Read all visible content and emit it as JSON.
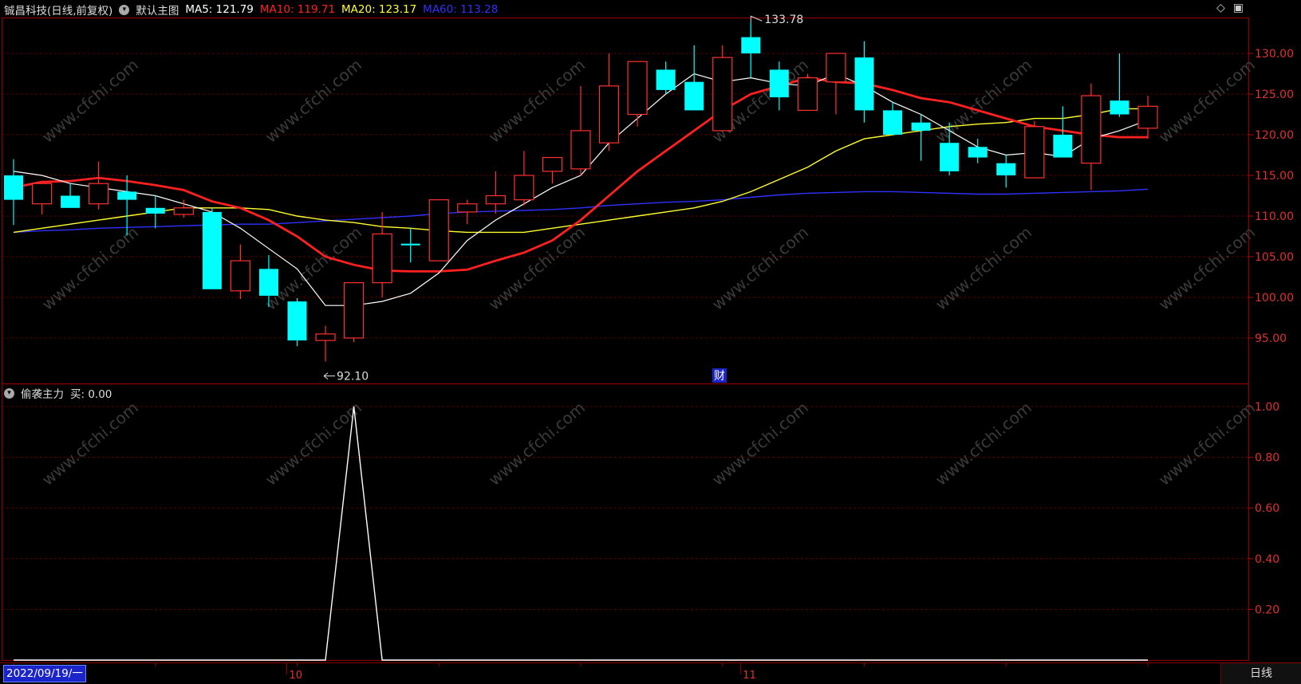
{
  "header": {
    "stock_name": "铖昌科技(日线,前复权)",
    "template": "默认主图",
    "ma5_label": "MA5: 121.79",
    "ma10_label": "MA10: 119.71",
    "ma20_label": "MA20: 123.17",
    "ma60_label": "MA60: 113.28",
    "ma5_color": "#ffffff",
    "ma10_color": "#ff2020",
    "ma20_color": "#ffff30",
    "ma60_color": "#3030ff"
  },
  "indicator": {
    "name": "偷袭主力",
    "buy_label": "买: 0.00"
  },
  "annotations": {
    "high_label": "133.78",
    "low_label": "92.10",
    "cai_badge": "财"
  },
  "watermark": "www.cfchi.com",
  "footer": {
    "date": "2022/09/19/一",
    "month_labels": [
      "10",
      "11"
    ],
    "period_button": "日线"
  },
  "icons": [
    "diamond-icon",
    "panel-icon"
  ],
  "chart_data": [
    {
      "type": "candlestick",
      "y_ticks": [
        "130.00",
        "125.00",
        "120.00",
        "115.00",
        "110.00",
        "105.00",
        "100.00",
        "95.00"
      ],
      "ylim": [
        90,
        135
      ],
      "grid": true,
      "colors": {
        "up": "#ff3030",
        "down": "#00ffff"
      },
      "candles": [
        {
          "o": 115.0,
          "h": 117.0,
          "l": 108.9,
          "c": 112.0
        },
        {
          "o": 111.5,
          "h": 114.0,
          "l": 110.2,
          "c": 114.0
        },
        {
          "o": 112.5,
          "h": 114.0,
          "l": 111.0,
          "c": 111.0
        },
        {
          "o": 111.5,
          "h": 116.7,
          "l": 110.8,
          "c": 114.0
        },
        {
          "o": 113.0,
          "h": 115.0,
          "l": 107.6,
          "c": 112.0
        },
        {
          "o": 111.0,
          "h": 112.5,
          "l": 108.5,
          "c": 110.3
        },
        {
          "o": 110.2,
          "h": 112.0,
          "l": 109.8,
          "c": 111.0
        },
        {
          "o": 110.5,
          "h": 111.0,
          "l": 101.0,
          "c": 101.0
        },
        {
          "o": 100.8,
          "h": 106.5,
          "l": 99.8,
          "c": 104.5
        },
        {
          "o": 103.5,
          "h": 105.2,
          "l": 98.8,
          "c": 100.2
        },
        {
          "o": 99.5,
          "h": 99.9,
          "l": 94.0,
          "c": 94.7
        },
        {
          "o": 94.7,
          "h": 96.5,
          "l": 92.1,
          "c": 95.5
        },
        {
          "o": 95.0,
          "h": 101.8,
          "l": 94.5,
          "c": 101.8
        },
        {
          "o": 101.8,
          "h": 110.5,
          "l": 100.0,
          "c": 107.8
        },
        {
          "o": 106.6,
          "h": 108.5,
          "l": 104.3,
          "c": 106.4
        },
        {
          "o": 104.5,
          "h": 112.0,
          "l": 104.5,
          "c": 112.0
        },
        {
          "o": 110.5,
          "h": 112.0,
          "l": 109.0,
          "c": 111.5
        },
        {
          "o": 111.5,
          "h": 115.5,
          "l": 110.3,
          "c": 112.5
        },
        {
          "o": 112.0,
          "h": 118.0,
          "l": 111.3,
          "c": 115.0
        },
        {
          "o": 115.5,
          "h": 117.0,
          "l": 114.0,
          "c": 117.2
        },
        {
          "o": 115.8,
          "h": 126.0,
          "l": 115.0,
          "c": 120.5
        },
        {
          "o": 119.0,
          "h": 130.0,
          "l": 118.0,
          "c": 126.0
        },
        {
          "o": 122.5,
          "h": 129.0,
          "l": 121.0,
          "c": 129.0
        },
        {
          "o": 128.0,
          "h": 129.0,
          "l": 125.0,
          "c": 125.5
        },
        {
          "o": 126.5,
          "h": 131.0,
          "l": 123.0,
          "c": 123.0
        },
        {
          "o": 120.5,
          "h": 131.0,
          "l": 120.5,
          "c": 129.5
        },
        {
          "o": 132.0,
          "h": 133.8,
          "l": 127.0,
          "c": 130.0
        },
        {
          "o": 128.0,
          "h": 129.0,
          "l": 123.0,
          "c": 124.6
        },
        {
          "o": 123.0,
          "h": 127.5,
          "l": 123.0,
          "c": 127.0
        },
        {
          "o": 126.5,
          "h": 130.0,
          "l": 122.5,
          "c": 130.0
        },
        {
          "o": 129.5,
          "h": 131.5,
          "l": 121.5,
          "c": 123.0
        },
        {
          "o": 123.0,
          "h": 124.0,
          "l": 120.0,
          "c": 120.0
        },
        {
          "o": 121.5,
          "h": 122.5,
          "l": 116.8,
          "c": 120.5
        },
        {
          "o": 119.0,
          "h": 121.5,
          "l": 115.0,
          "c": 115.5
        },
        {
          "o": 118.5,
          "h": 119.5,
          "l": 116.5,
          "c": 117.2
        },
        {
          "o": 116.5,
          "h": 117.5,
          "l": 113.5,
          "c": 115.0
        },
        {
          "o": 114.7,
          "h": 121.7,
          "l": 114.7,
          "c": 121.0
        },
        {
          "o": 120.0,
          "h": 123.5,
          "l": 117.2,
          "c": 117.2
        },
        {
          "o": 116.5,
          "h": 126.3,
          "l": 113.2,
          "c": 124.8
        },
        {
          "o": 124.2,
          "h": 130.0,
          "l": 122.2,
          "c": 122.5
        },
        {
          "o": 120.8,
          "h": 124.8,
          "l": 119.5,
          "c": 123.5
        }
      ],
      "ma5": [
        115.5,
        115.0,
        114.0,
        113.5,
        113.0,
        112.5,
        111.5,
        110.5,
        108.5,
        106.0,
        103.5,
        99.0,
        99.0,
        99.5,
        100.5,
        103.0,
        107.0,
        109.5,
        111.5,
        113.5,
        115.0,
        119.0,
        122.0,
        125.0,
        127.5,
        126.5,
        127.0,
        126.3,
        126.0,
        127.5,
        126.0,
        124.0,
        122.5,
        120.5,
        118.5,
        117.5,
        117.8,
        117.3,
        119.5,
        120.5,
        121.8
      ],
      "ma10": [
        113.5,
        114.2,
        114.3,
        114.7,
        114.3,
        113.8,
        113.2,
        111.8,
        111.0,
        109.5,
        107.5,
        105.0,
        104.0,
        103.3,
        103.2,
        103.2,
        103.4,
        104.5,
        105.5,
        107.0,
        109.5,
        112.5,
        115.5,
        118.0,
        120.5,
        123.0,
        125.0,
        126.0,
        127.0,
        126.5,
        126.3,
        125.5,
        124.5,
        124.0,
        123.0,
        122.0,
        121.0,
        120.5,
        120.0,
        119.7,
        119.7
      ],
      "ma20": [
        108.0,
        108.5,
        109.0,
        109.5,
        110.0,
        110.5,
        111.0,
        111.0,
        111.0,
        110.8,
        110.0,
        109.5,
        109.2,
        108.7,
        108.5,
        108.2,
        108.0,
        108.0,
        108.0,
        108.5,
        109.0,
        109.5,
        110.0,
        110.5,
        111.0,
        111.8,
        113.0,
        114.5,
        116.0,
        118.0,
        119.5,
        120.0,
        120.5,
        121.0,
        121.3,
        121.5,
        122.0,
        122.0,
        122.5,
        123.2,
        123.2
      ],
      "ma60": [
        108.0,
        108.2,
        108.3,
        108.5,
        108.6,
        108.7,
        108.8,
        108.9,
        109.0,
        109.0,
        109.2,
        109.4,
        109.6,
        109.8,
        110.0,
        110.3,
        110.5,
        110.6,
        110.7,
        110.8,
        111.0,
        111.3,
        111.5,
        111.7,
        111.8,
        112.0,
        112.3,
        112.6,
        112.8,
        112.9,
        113.0,
        113.0,
        112.9,
        112.8,
        112.7,
        112.7,
        112.8,
        112.9,
        113.0,
        113.1,
        113.3
      ]
    },
    {
      "type": "line",
      "y_ticks": [
        "1.00",
        "0.80",
        "0.60",
        "0.40",
        "0.20"
      ],
      "ylim": [
        0,
        1
      ],
      "grid": true,
      "series": [
        {
          "values": [
            0,
            0,
            0,
            0,
            0,
            0,
            0,
            0,
            0,
            0,
            0,
            0,
            1,
            0,
            0,
            0,
            0,
            0,
            0,
            0,
            0,
            0,
            0,
            0,
            0,
            0,
            0,
            0,
            0,
            0,
            0,
            0,
            0,
            0,
            0,
            0,
            0,
            0,
            0,
            0,
            0
          ]
        }
      ]
    }
  ]
}
